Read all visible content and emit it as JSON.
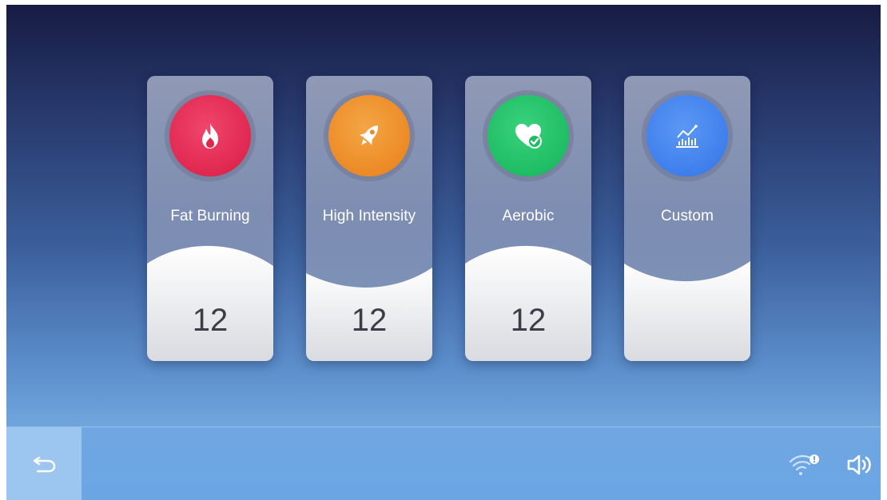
{
  "modes": [
    {
      "label": "Fat Burning",
      "count": "12",
      "icon": "flame-icon",
      "color": "#e0284f"
    },
    {
      "label": "High Intensity",
      "count": "12",
      "icon": "rocket-icon",
      "color": "#ec8a25"
    },
    {
      "label": "Aerobic",
      "count": "12",
      "icon": "heart-check-icon",
      "color": "#1fbd64"
    },
    {
      "label": "Custom",
      "count": "",
      "icon": "chart-icon",
      "color": "#3f7fec"
    }
  ],
  "bottom_bar": {
    "back_icon": "back-arrow-icon",
    "wifi_icon": "wifi-alert-icon",
    "sound_icon": "speaker-icon"
  }
}
